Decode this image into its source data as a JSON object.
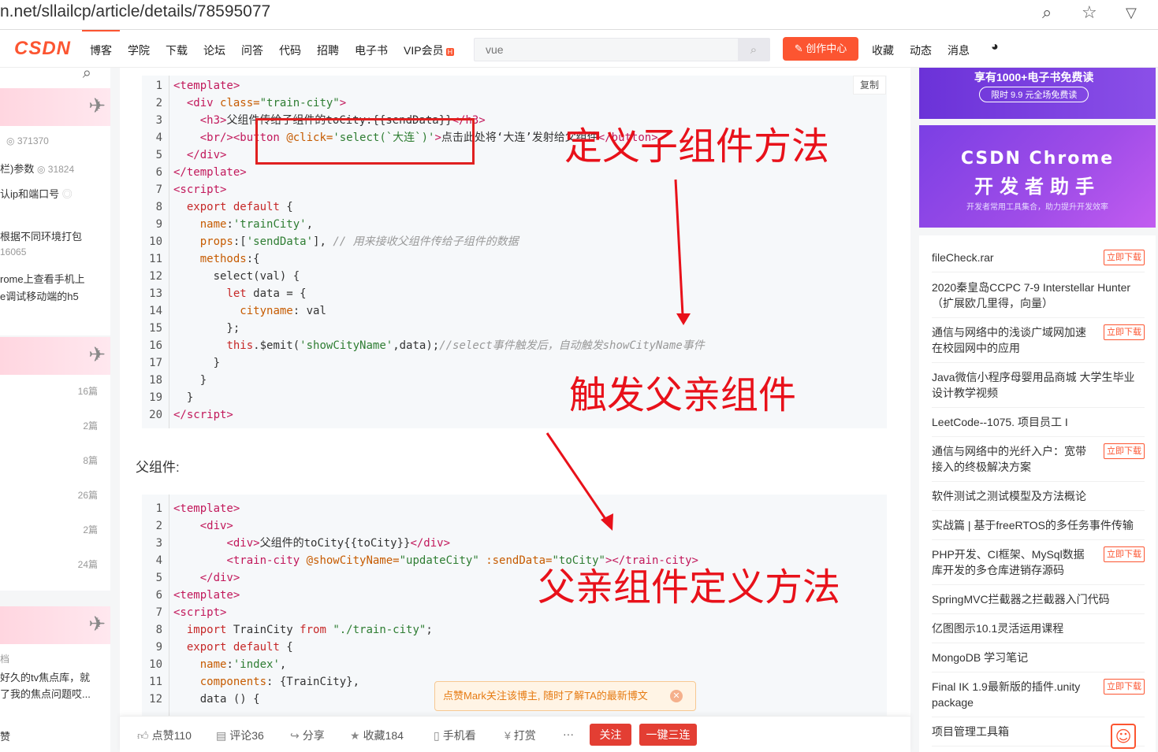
{
  "browser": {
    "url": "n.net/sllailcp/article/details/78595077"
  },
  "nav": {
    "logo": "CSDN",
    "items": [
      "博客",
      "学院",
      "下载",
      "论坛",
      "问答",
      "代码",
      "招聘",
      "电子书",
      "VIP会员"
    ],
    "vip_badge": "H",
    "search_placeholder": "vue",
    "create_label": "创作中心",
    "right_items": [
      "收藏",
      "动态",
      "消息"
    ]
  },
  "left_sidebar": {
    "rows": [
      {
        "text": "371370",
        "style": "small"
      },
      {
        "text": "栏)参数",
        "count": "31824"
      },
      {
        "text": "认ip和端口号"
      },
      {
        "text": "根据不同环境打包"
      },
      {
        "text": "16065",
        "style": "small"
      },
      {
        "text": "rome上查看手机上"
      },
      {
        "text": "e调试移动端的h5"
      }
    ],
    "counts": [
      "16篇",
      "2篇",
      "8篇",
      "26篇",
      "2篇",
      "24篇"
    ],
    "bottom_rows": [
      "档",
      "好久的tv焦点库，就",
      "了我的焦点问题哎...",
      "赞"
    ]
  },
  "article": {
    "copy_label": "复制",
    "code_block_1": [
      {
        "n": "1",
        "html": "<span class='tag'>&lt;template&gt;</span>"
      },
      {
        "n": "2",
        "html": "  <span class='tag'>&lt;div</span> <span class='attr'>class=</span><span class='str'>\"train-city\"</span><span class='tag'>&gt;</span>"
      },
      {
        "n": "3",
        "html": "    <span class='tag'>&lt;h3&gt;</span>父组件传给子组件的toCity:{{sendData}}<span class='tag'>&lt;/h3&gt;</span>"
      },
      {
        "n": "4",
        "html": "    <span class='tag'>&lt;br/&gt;&lt;button</span> <span class='attr'>@click=</span><span class='str'>'select(`大连`)'</span><span class='tag'>&gt;</span>点击此处将‘大连’发射给父组件<span class='tag'>&lt;/button&gt;</span>"
      },
      {
        "n": "5",
        "html": "  <span class='tag'>&lt;/div&gt;</span>"
      },
      {
        "n": "6",
        "html": "<span class='tag'>&lt;/template&gt;</span>"
      },
      {
        "n": "7",
        "html": "<span class='tag'>&lt;script&gt;</span>"
      },
      {
        "n": "8",
        "html": "  <span class='kw'>export default</span> {"
      },
      {
        "n": "9",
        "html": "    <span class='attr'>name</span>:<span class='str'>'trainCity'</span>,"
      },
      {
        "n": "10",
        "html": "    <span class='attr'>props</span>:[<span class='str'>'sendData'</span>], <span class='cmt'>// 用来接收父组件传给子组件的数据</span>"
      },
      {
        "n": "11",
        "html": "    <span class='attr'>methods</span>:{"
      },
      {
        "n": "12",
        "html": "      select(val) {"
      },
      {
        "n": "13",
        "html": "        <span class='kw'>let</span> data = {"
      },
      {
        "n": "14",
        "html": "          <span class='attr'>cityname</span>: val"
      },
      {
        "n": "15",
        "html": "        };"
      },
      {
        "n": "16",
        "html": "        <span class='kw'>this</span>.$emit(<span class='str'>'showCityName'</span>,data);<span class='cmt'>//select事件触发后，自动触发showCityName事件</span>"
      },
      {
        "n": "17",
        "html": "      }"
      },
      {
        "n": "18",
        "html": "    }"
      },
      {
        "n": "19",
        "html": "  }"
      },
      {
        "n": "20",
        "html": "<span class='tag'>&lt;/script&gt;</span>"
      }
    ],
    "section_label": "父组件:",
    "code_block_2": [
      {
        "n": "1",
        "html": "<span class='tag'>&lt;template&gt;</span>"
      },
      {
        "n": "2",
        "html": "    <span class='tag'>&lt;div&gt;</span>"
      },
      {
        "n": "3",
        "html": "        <span class='tag'>&lt;div&gt;</span>父组件的toCity{{toCity}}<span class='tag'>&lt;/div&gt;</span>"
      },
      {
        "n": "4",
        "html": "        <span class='tag'>&lt;train-city</span> <span class='attr'>@showCityName=</span><span class='str'>\"updateCity\"</span> <span class='attr'>:sendData=</span><span class='str'>\"toCity\"</span><span class='tag'>&gt;&lt;/train-city&gt;</span>"
      },
      {
        "n": "5",
        "html": "    <span class='tag'>&lt;/div&gt;</span>"
      },
      {
        "n": "6",
        "html": "<span class='tag'>&lt;template&gt;</span>"
      },
      {
        "n": "7",
        "html": "<span class='tag'>&lt;script&gt;</span>"
      },
      {
        "n": "8",
        "html": "  <span class='kw'>import</span> TrainCity <span class='kw'>from</span> <span class='str'>\"./train-city\"</span>;"
      },
      {
        "n": "9",
        "html": "  <span class='kw'>export default</span> {"
      },
      {
        "n": "10",
        "html": "    <span class='attr'>name</span>:<span class='str'>'index'</span>,"
      },
      {
        "n": "11",
        "html": "    <span class='attr'>components</span>: {TrainCity},"
      },
      {
        "n": "12",
        "html": "    data () {"
      }
    ],
    "annotations": [
      "定义子组件方法",
      "触发父亲组件",
      "父亲组件定义方法"
    ],
    "notice": "点赞Mark关注该博主, 随时了解TA的最新博文"
  },
  "toolbar": {
    "like": "点赞110",
    "comment": "评论36",
    "share": "分享",
    "collect": "收藏184",
    "mobile": "手机看",
    "reward": "打赏",
    "more": "···",
    "follow": "关注",
    "triple": "一键三连"
  },
  "right_sidebar": {
    "banner1_title": "享有1000+电子书免费读",
    "banner1_sub": "限时 9.9 元全场免费读",
    "banner2_title": "CSDN Chrome",
    "banner2_sub": "开发者助手",
    "banner2_desc": "开发者常用工具集合，助力提升开发效率",
    "download_label": "立即下载",
    "items": [
      {
        "text": "fileCheck.rar",
        "download": true
      },
      {
        "text": "2020秦皇岛CCPC 7-9 Interstellar Hunter（扩展欧几里得，向量）",
        "download": false
      },
      {
        "text": "通信与网络中的浅谈广域网加速在校园网中的应用",
        "download": true
      },
      {
        "text": "Java微信小程序母婴用品商城 大学生毕业设计教学视频",
        "download": false
      },
      {
        "text": "LeetCode--1075. 项目员工 I",
        "download": false
      },
      {
        "text": "通信与网络中的光纤入户：宽带接入的终极解决方案",
        "download": true
      },
      {
        "text": "软件测试之测试模型及方法概论",
        "download": false
      },
      {
        "text": "实战篇 | 基于freeRTOS的多任务事件传输",
        "download": false
      },
      {
        "text": "PHP开发、CI框架、MySql数据库开发的多仓库进销存源码",
        "download": true
      },
      {
        "text": "SpringMVC拦截器之拦截器入门代码",
        "download": false
      },
      {
        "text": "亿图图示10.1灵活运用课程",
        "download": false
      },
      {
        "text": "MongoDB 学习笔记",
        "download": false
      },
      {
        "text": "Final IK 1.9最新版的插件.unity package",
        "download": true
      },
      {
        "text": "项目管理工具箱",
        "download": false
      }
    ]
  }
}
